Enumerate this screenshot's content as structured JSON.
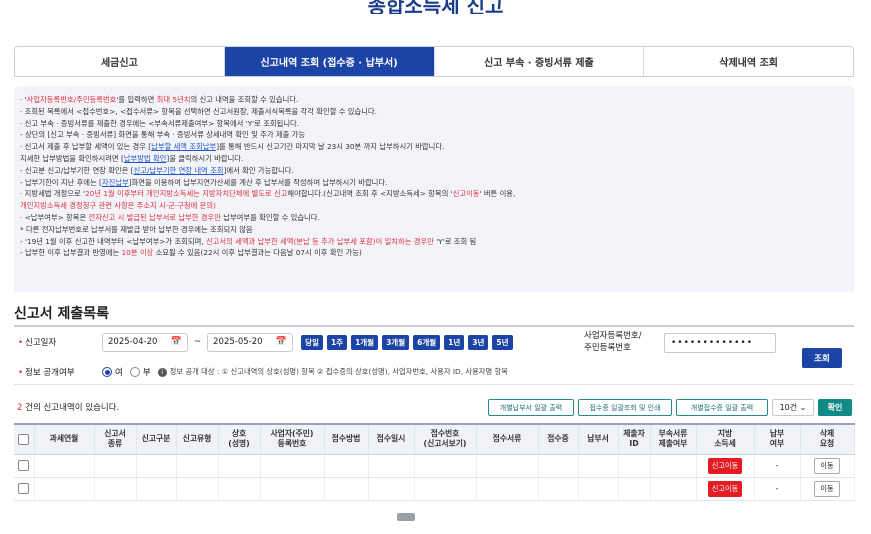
{
  "page": {
    "title": "종합소득세 신고"
  },
  "tabs": [
    {
      "label": "세금신고",
      "active": false
    },
    {
      "label": "신고내역 조회 (접수증 · 납부서)",
      "active": true
    },
    {
      "label": "신고 부속 · 증빙서류 제출",
      "active": false
    },
    {
      "label": "삭제내역 조회",
      "active": false
    }
  ],
  "notice": {
    "l1a": "· '",
    "l1b": "사업자등록번호/주민등록번호",
    "l1c": "'를 입력하면 ",
    "l1d": "최대 5년치",
    "l1e": "의 신고 내역을 조회할 수 있습니다.",
    "l2": "· 조회된 목록에서 <접수번호>, <접수서류> 항목을 선택하면 신고서원장, 제출서식목록을 각각 확인할 수 있습니다.",
    "l3": "· 신고 부속 · 증빙서류를 제출한 경우에는 <부속서류제출여부> 항목에서 'Y'로 조회됩니다.",
    "l4": "  - 상단의 [신고 부속 · 증빙서류] 화면을 통해 부속 · 증빙서류 상세내역 확인 및 추가 제출 가능",
    "l5a": "· 신고서 제출 후 납부할 세액이 있는 경우 [",
    "l5b": "납부할 세액 조회납부",
    "l5c": "]를 통해 반드시 신고기간 마지막 날 23시 30분 까지 납부하시기 바랍니다.",
    "l6a": "  지세한 납부방법을 확인하시려면 [",
    "l6b": "납부방법 확인",
    "l6c": "]을 클릭하시기 바랍니다.",
    "l7a": "  - 신고분 신고/납부기한 연장 확인은 [",
    "l7b": "신고/납부기한 연장 내역 조회",
    "l7c": "]에서 확인 가능합니다.",
    "l8a": "  - 납부기한이 지난 후에는 [",
    "l8b": "자진납부",
    "l8c": "]화면을 이용하여 납부지연가산세를 계산 후 납부서를 작성하여 납부하시기 바랍니다.",
    "l9a": "· 지방세법 개정으로 '",
    "l9b": "20년 1월 이후부터 개인지방소득세는 지방자치단체에 별도로 신고",
    "l9c": "해야합니다.(신고내역 조회 후 <지방소득세> 항목의 '",
    "l9d": "신고이동",
    "l9e": "' 버튼 이용,",
    "l10": "  개인지방소득세 경정청구 관련 사항은 주소지 시·군·구청에 문의)",
    "l11a": "· <납부여부> 항목은 ",
    "l11b": "전자신고 시 발급된 납부서로 납부한 경우만",
    "l11c": " 납부여부를 확인할 수 있습니다.",
    "l12": "   * 다른 전자납부번호로 납부서를 재발급 받아 납부한 경우에는 조회되지 않음",
    "l13a": "  - '19년 1월 이후 신고한 내역부터 <납부여부>가 조회되며, ",
    "l13b": "신고서의 세액과 납부한 세액(분납 등 추가 납부세 포함)이 일치하는 경우만",
    "l13c": " 'Y'로 조회 됨",
    "l14a": "  - 납부한 이후 납부결과 반영에는 ",
    "l14b": "10분 이상",
    "l14c": " 소요될 수 있음(22시 이후 납부결과는 다음날 07시 이후 확인 가능)"
  },
  "section": {
    "title": "신고서 제출목록"
  },
  "search": {
    "date_label": "신고일자",
    "date_from": "2025-04-20",
    "tilde": "~",
    "date_to": "2025-05-20",
    "periods": [
      "당일",
      "1주",
      "1개월",
      "3개월",
      "6개월",
      "1년",
      "3년",
      "5년"
    ],
    "biz_label_1": "사업자등록번호/",
    "biz_label_2": "주민등록번호",
    "biz_value": "•••••••••••••",
    "search_button": "조회",
    "disclosure_label": "정보 공개여부",
    "opt_yes": "여",
    "opt_no": "부",
    "disclosure_note": "정보 공개 대상 : ① 신고내역의 상호(성명) 항목 ② 접수증의 상호(성명), 사업자번호, 사용자 ID, 사용자명 항목",
    "info": "i"
  },
  "results": {
    "count": "2",
    "count_text": " 건의 신고내역이 있습니다.",
    "btn_individual": "개별납부서 일괄 출력",
    "btn_receipt": "접수증 일괄조회 및 인쇄",
    "btn_individual_receipt": "개별접수증 일괄 출력",
    "page_size": "10건",
    "confirm": "확인"
  },
  "table": {
    "headers": [
      "과세연월",
      "신고서\n종류",
      "신고구분",
      "신고유형",
      "상호\n(성명)",
      "사업자(주민)\n등록번호",
      "접수방법",
      "접수일시",
      "접수번호\n(신고서보기)",
      "접수서류",
      "접수증",
      "납부서",
      "제출자\nID",
      "부속서류\n제출여부",
      "지방\n소득세",
      "납부\n여부",
      "삭제\n요청"
    ],
    "rows": [
      {
        "local_tax": "신고이동",
        "paid": "-",
        "delete": "이동"
      },
      {
        "local_tax": "신고이동",
        "paid": "-",
        "delete": "이동"
      }
    ]
  },
  "colors": {
    "primary": "#1c43a6",
    "accent_red": "#e0303a",
    "teal": "#0f8a84"
  }
}
